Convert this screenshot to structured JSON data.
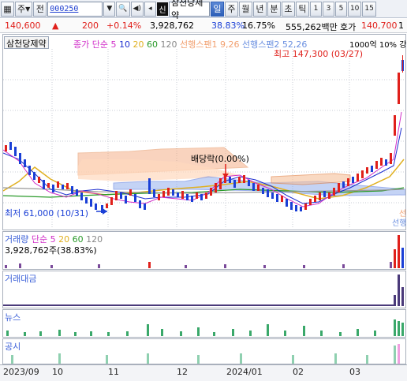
{
  "toolbar": {
    "market": "주",
    "view": "전",
    "code": "000250",
    "stock_name": "삼천당제약",
    "shin": "신",
    "periods": [
      "일",
      "주",
      "월",
      "년",
      "분",
      "초",
      "틱"
    ],
    "active_period": "일",
    "intervals": [
      "1",
      "3",
      "5",
      "10",
      "15"
    ]
  },
  "quote": {
    "price": "140,600",
    "arrow": "▲",
    "change": "200",
    "change_pct": "+0.14%",
    "volume": "3,928,762",
    "vol_ratio": "38.83%",
    "turnover": "16.75%",
    "market_cap": "555,262백만",
    "ask_label": "호가",
    "ask": "140,700",
    "trailing": "1"
  },
  "colors": {
    "up": "#e0201b",
    "down": "#1a3fd6",
    "ma5": "#d02ec8",
    "ma10": "#1e2fd0",
    "ma20": "#e0b020",
    "ma60": "#2a9a2a",
    "ma120": "#888888",
    "cloud_up": "#f2a070",
    "cloud_down": "#6a8fe0"
  },
  "main_panel": {
    "title": "삼천당제약",
    "legend_close": "종가 단순",
    "ma_periods": [
      "5",
      "10",
      "20",
      "60",
      "120"
    ],
    "leading_span1": "선행스팬1 9,26",
    "leading_span2": "선행스팬2 52,26",
    "extra": "1000억 10% 강",
    "high_label": "최고 147,300 (03/27)",
    "low_label": "최저 61,000 (10/31)",
    "dividend_label": "배당락(0.00%)",
    "right_cut1": "선",
    "right_cut2": "선행"
  },
  "volume_panel": {
    "title": "거래량",
    "ma_label": "단순",
    "ma_periods": [
      "5",
      "20",
      "60",
      "120"
    ],
    "value": "3,928,762주(38.83%)"
  },
  "amount_panel": {
    "title": "거래대금"
  },
  "news_panel": {
    "title": "뉴스"
  },
  "disclosure_panel": {
    "title": "공시"
  },
  "x_axis": {
    "labels": [
      "2023/09",
      "10",
      "11",
      "12",
      "2024/01",
      "02",
      "03"
    ]
  },
  "chart_data": {
    "type": "candlestick",
    "title": "삼천당제약",
    "x_range": [
      "2023/09",
      "2024/03"
    ],
    "y_range": [
      61000,
      147300
    ],
    "annotations": [
      {
        "label": "최고 147,300 (03/27)",
        "date": "03/27",
        "value": 147300
      },
      {
        "label": "최저 61,000 (10/31)",
        "date": "10/31",
        "value": 61000
      },
      {
        "label": "배당락(0.00%)"
      }
    ],
    "approx_closes": [
      82000,
      80000,
      79000,
      76000,
      73000,
      70000,
      68000,
      66000,
      64000,
      62000,
      63000,
      65000,
      66000,
      64000,
      66000,
      68000,
      70000,
      72000,
      74000,
      73000,
      71000,
      70000,
      69000,
      69000,
      71000,
      73000,
      74000,
      72000,
      70000,
      68000,
      67000,
      66000,
      65000,
      64000,
      63000,
      64000,
      67000,
      69000,
      72000,
      76000,
      82000,
      92000,
      108000,
      128000,
      140600
    ],
    "volume_series": [
      {
        "name": "거래량",
        "last_value": 3928762,
        "last_ratio_pct": 38.83
      }
    ]
  }
}
